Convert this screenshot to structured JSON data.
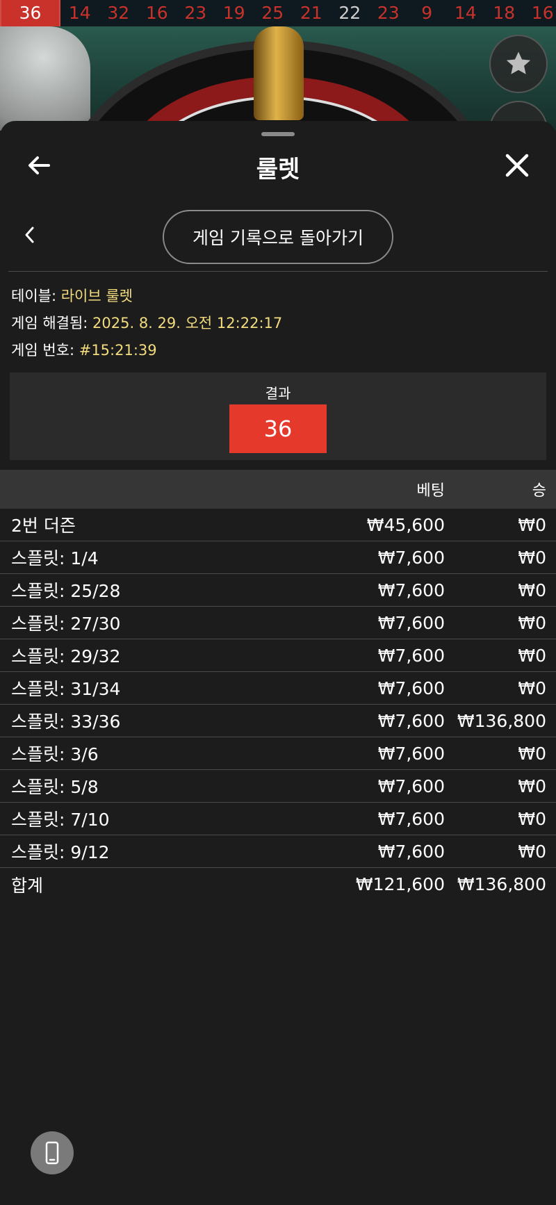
{
  "number_strip": [
    {
      "value": "36",
      "color": "red"
    },
    {
      "value": "14",
      "color": "red"
    },
    {
      "value": "32",
      "color": "red"
    },
    {
      "value": "16",
      "color": "red"
    },
    {
      "value": "23",
      "color": "red"
    },
    {
      "value": "19",
      "color": "red"
    },
    {
      "value": "25",
      "color": "red"
    },
    {
      "value": "21",
      "color": "red"
    },
    {
      "value": "22",
      "color": "black"
    },
    {
      "value": "23",
      "color": "red"
    },
    {
      "value": "9",
      "color": "red"
    },
    {
      "value": "14",
      "color": "red"
    },
    {
      "value": "18",
      "color": "red"
    },
    {
      "value": "16",
      "color": "red"
    }
  ],
  "header": {
    "title": "룰렛",
    "back_icon": "arrow-left-icon",
    "close_icon": "close-icon"
  },
  "nav": {
    "back_to_history_label": "게임 기록으로 돌아가기",
    "prev_icon": "chevron-left-icon"
  },
  "info": {
    "table_label": "테이블: ",
    "table_value": "라이브 룰렛",
    "resolved_label": "게임 해결됨: ",
    "resolved_value": "2025. 8. 29. 오전 12:22:17",
    "game_no_label": "게임 번호: ",
    "game_no_value": "#15:21:39"
  },
  "result": {
    "label": "결과",
    "number": "36",
    "color": "#e5392b"
  },
  "table": {
    "headers": {
      "name": "",
      "bet": "베팅",
      "win": "승"
    },
    "rows": [
      {
        "name": "2번 더즌",
        "bet": "₩45,600",
        "win": "₩0"
      },
      {
        "name": "스플릿: 1/4",
        "bet": "₩7,600",
        "win": "₩0"
      },
      {
        "name": "스플릿: 25/28",
        "bet": "₩7,600",
        "win": "₩0"
      },
      {
        "name": "스플릿: 27/30",
        "bet": "₩7,600",
        "win": "₩0"
      },
      {
        "name": "스플릿: 29/32",
        "bet": "₩7,600",
        "win": "₩0"
      },
      {
        "name": "스플릿: 31/34",
        "bet": "₩7,600",
        "win": "₩0"
      },
      {
        "name": "스플릿: 33/36",
        "bet": "₩7,600",
        "win": "₩136,800"
      },
      {
        "name": "스플릿: 3/6",
        "bet": "₩7,600",
        "win": "₩0"
      },
      {
        "name": "스플릿: 5/8",
        "bet": "₩7,600",
        "win": "₩0"
      },
      {
        "name": "스플릿: 7/10",
        "bet": "₩7,600",
        "win": "₩0"
      },
      {
        "name": "스플릿: 9/12",
        "bet": "₩7,600",
        "win": "₩0"
      }
    ],
    "total": {
      "name": "합계",
      "bet": "₩121,600",
      "win": "₩136,800"
    }
  },
  "icons": {
    "favorite": "star-icon",
    "phone": "phone-icon"
  }
}
